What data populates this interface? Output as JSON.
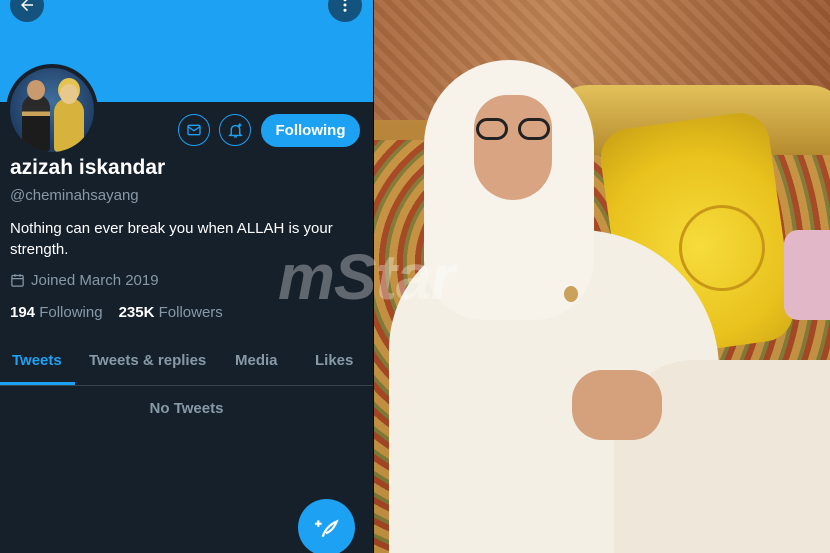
{
  "header": {
    "back_icon": "arrow-left-icon",
    "more_icon": "more-vertical-icon",
    "banner_color": "#1da1f2"
  },
  "profile": {
    "name": "azizah iskandar",
    "handle": "@cheminahsayang",
    "bio": "Nothing can ever break you when ALLAH is your strength.",
    "joined": "Joined March 2019",
    "following_count": "194",
    "following_label": "Following",
    "followers_count": "235K",
    "followers_label": "Followers"
  },
  "actions": {
    "message_icon": "mail-icon",
    "notify_icon": "bell-plus-icon",
    "follow_label": "Following"
  },
  "tabs": [
    {
      "label": "Tweets",
      "active": true
    },
    {
      "label": "Tweets & replies",
      "active": false
    },
    {
      "label": "Media",
      "active": false
    },
    {
      "label": "Likes",
      "active": false
    }
  ],
  "feed": {
    "empty_text": "No Tweets"
  },
  "compose": {
    "icon": "compose-feather-icon"
  },
  "photo": {
    "watermark_text": "mStar"
  },
  "colors": {
    "accent": "#1da1f2",
    "background": "#15202b",
    "muted": "#8899a6"
  }
}
